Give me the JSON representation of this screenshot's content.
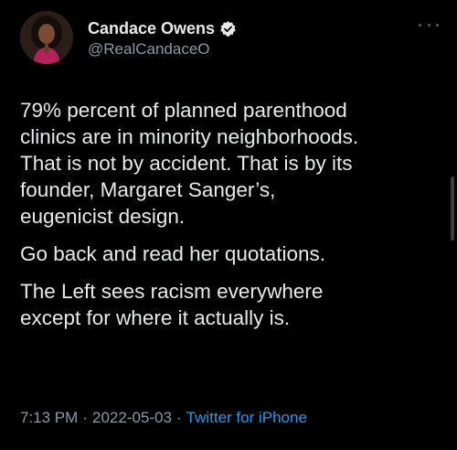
{
  "author": {
    "display_name": "Candace Owens",
    "handle": "@RealCandaceO",
    "verified": true,
    "avatar_icon": "profile-photo"
  },
  "tweet": {
    "paragraphs": [
      "79% percent of planned parenthood\nclinics are in minority neighborhoods.\nThat is not by accident. That is by its\nfounder, Margaret Sanger’s,\neugenicist design.",
      "Go back and read her quotations.",
      "The Left sees racism everywhere\nexcept for where it actually is."
    ],
    "time": "7:13 PM",
    "date": "2022-05-03",
    "separator": "·",
    "source": "Twitter for iPhone"
  },
  "icons": {
    "verified": "verified-badge-icon",
    "more": "more-options-icon"
  },
  "colors": {
    "background": "#000000",
    "text": "#e7e9ea",
    "secondary": "#8b98a5",
    "link": "#1d9bf0"
  }
}
